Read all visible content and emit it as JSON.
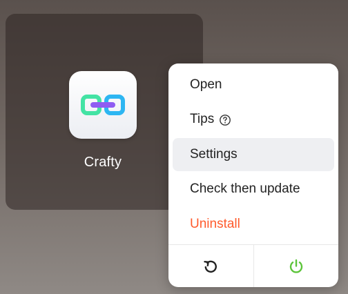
{
  "app": {
    "name": "Crafty",
    "icon": "chain-link-icon"
  },
  "menu": {
    "open_label": "Open",
    "tips_label": "Tips",
    "settings_label": "Settings",
    "check_update_label": "Check then update",
    "uninstall_label": "Uninstall",
    "hovered_item": "Settings",
    "footer": {
      "restart_icon": "restart-icon",
      "power_icon": "power-icon"
    }
  },
  "colors": {
    "danger": "#ff5a2c",
    "power_green": "#5cc43a",
    "link_green": "#43e3a4",
    "link_blue": "#2db6f2",
    "link_purple": "#8f5cf2"
  }
}
